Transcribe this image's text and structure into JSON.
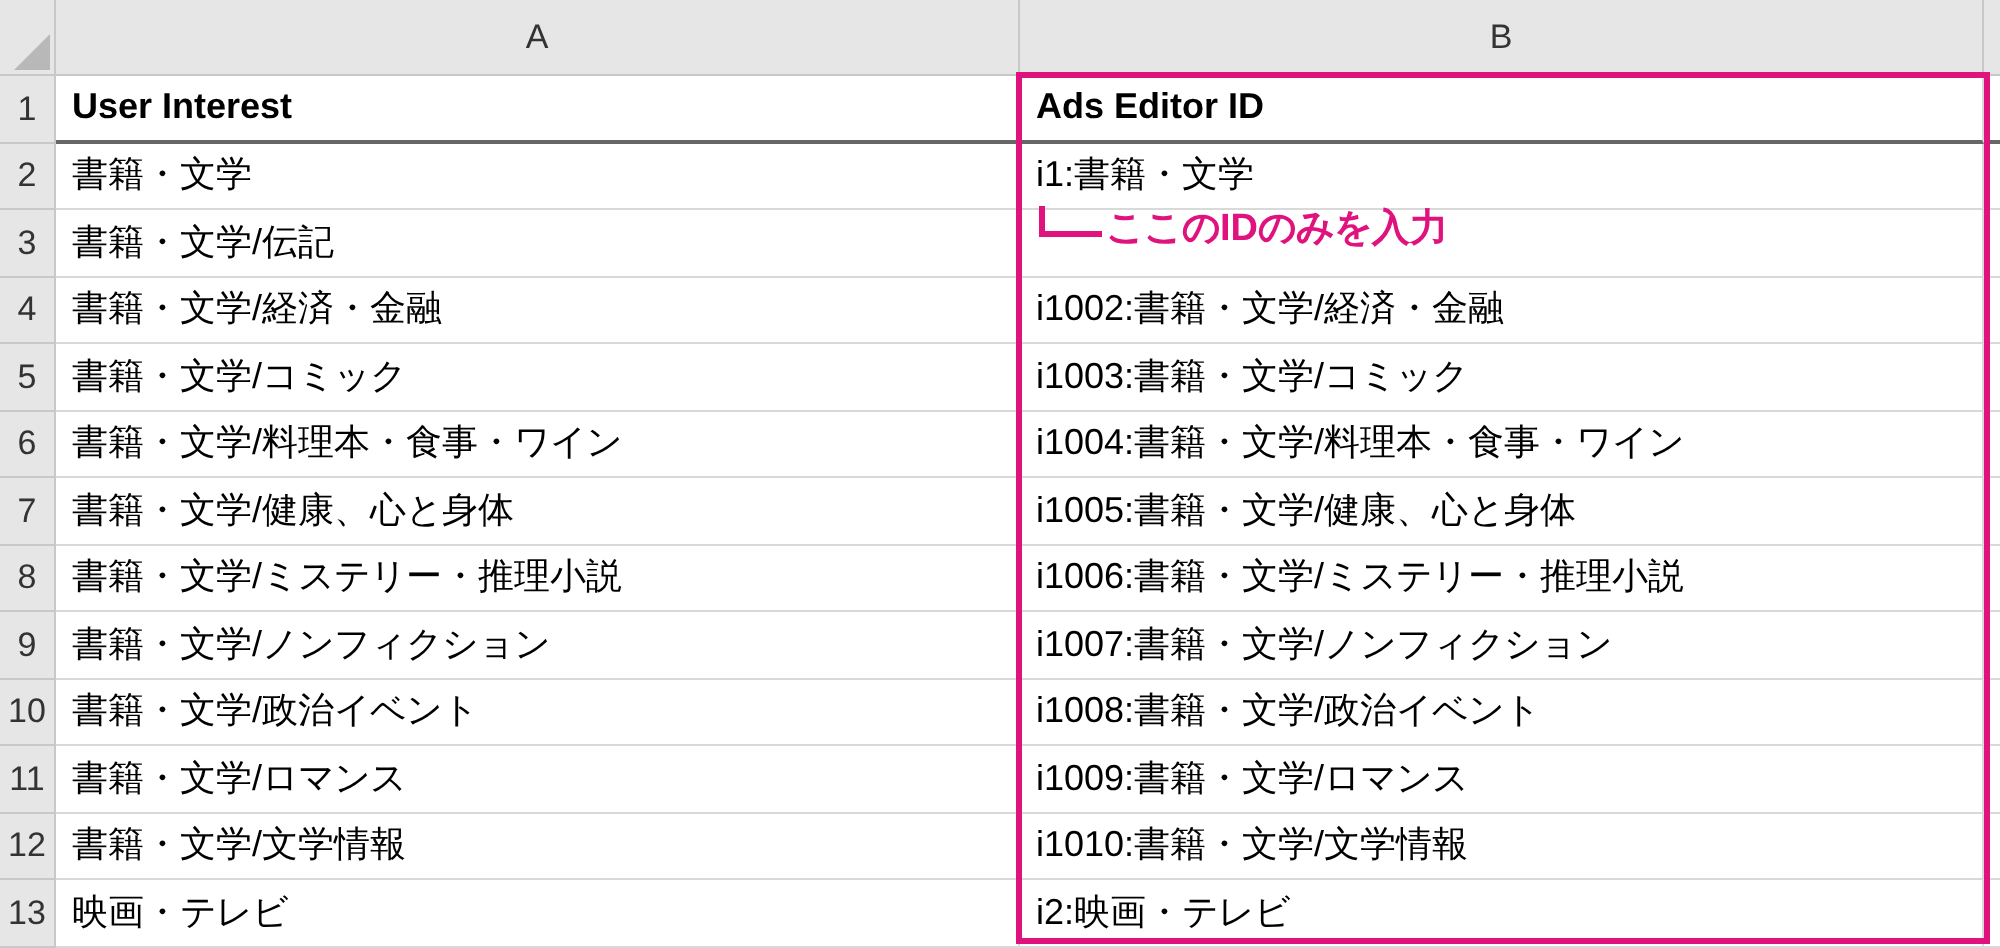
{
  "columns": [
    "A",
    "B"
  ],
  "rows": [
    {
      "number": "1",
      "cells": [
        "User Interest",
        "Ads Editor ID"
      ],
      "kind": "header"
    },
    {
      "number": "2",
      "cells": [
        "書籍・文学",
        "i1:書籍・文学"
      ],
      "kind": "data"
    },
    {
      "number": "3",
      "cells": [
        "書籍・文学/伝記",
        ""
      ],
      "kind": "data"
    },
    {
      "number": "4",
      "cells": [
        "書籍・文学/経済・金融",
        "i1002:書籍・文学/経済・金融"
      ],
      "kind": "data"
    },
    {
      "number": "5",
      "cells": [
        "書籍・文学/コミック",
        "i1003:書籍・文学/コミック"
      ],
      "kind": "data"
    },
    {
      "number": "6",
      "cells": [
        "書籍・文学/料理本・食事・ワイン",
        "i1004:書籍・文学/料理本・食事・ワイン"
      ],
      "kind": "data"
    },
    {
      "number": "7",
      "cells": [
        "書籍・文学/健康、心と身体",
        "i1005:書籍・文学/健康、心と身体"
      ],
      "kind": "data"
    },
    {
      "number": "8",
      "cells": [
        "書籍・文学/ミステリー・推理小説",
        "i1006:書籍・文学/ミステリー・推理小説"
      ],
      "kind": "data"
    },
    {
      "number": "9",
      "cells": [
        "書籍・文学/ノンフィクション",
        "i1007:書籍・文学/ノンフィクション"
      ],
      "kind": "data"
    },
    {
      "number": "10",
      "cells": [
        "書籍・文学/政治イベント",
        "i1008:書籍・文学/政治イベント"
      ],
      "kind": "data"
    },
    {
      "number": "11",
      "cells": [
        "書籍・文学/ロマンス",
        "i1009:書籍・文学/ロマンス"
      ],
      "kind": "data"
    },
    {
      "number": "12",
      "cells": [
        "書籍・文学/文学情報",
        "i1010:書籍・文学/文学情報"
      ],
      "kind": "data"
    },
    {
      "number": "13",
      "cells": [
        "映画・テレビ",
        "i2:映画・テレビ"
      ],
      "kind": "data"
    }
  ],
  "annotation": {
    "text": "ここのIDのみを入力",
    "color": "#e0137e"
  }
}
